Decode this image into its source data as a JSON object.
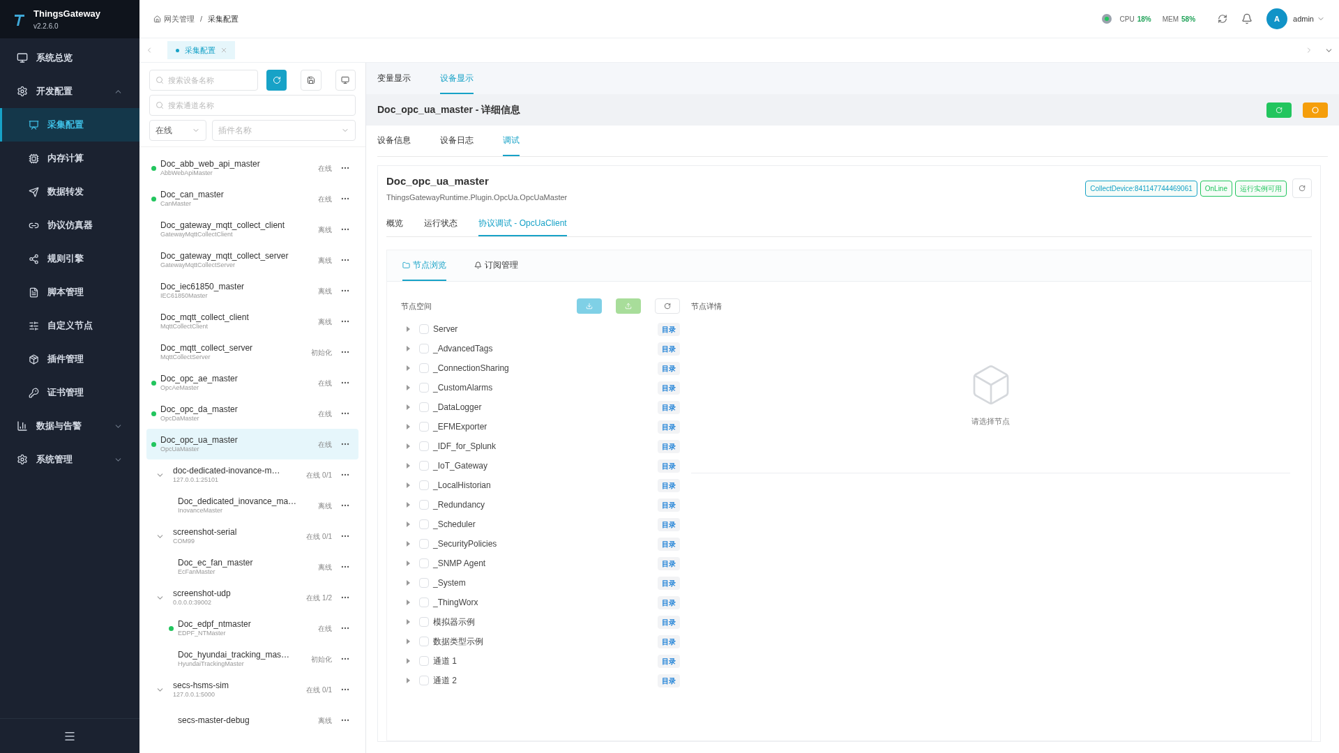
{
  "sidebar": {
    "app_name": "ThingsGateway",
    "version": "v2.2.6.0",
    "items": [
      {
        "label": "系统总览",
        "kind": "item",
        "selected": false
      },
      {
        "label": "开发配置",
        "kind": "group",
        "expanded": true,
        "children": [
          {
            "label": "采集配置",
            "selected": true
          },
          {
            "label": "内存计算",
            "selected": false
          },
          {
            "label": "数据转发",
            "selected": false
          },
          {
            "label": "协议仿真器",
            "selected": false
          },
          {
            "label": "规则引擎",
            "selected": false
          },
          {
            "label": "脚本管理",
            "selected": false
          },
          {
            "label": "自定义节点",
            "selected": false
          },
          {
            "label": "插件管理",
            "selected": false
          },
          {
            "label": "证书管理",
            "selected": false
          }
        ]
      },
      {
        "label": "数据与告警",
        "kind": "group",
        "expanded": false
      },
      {
        "label": "系统管理",
        "kind": "group",
        "expanded": false
      }
    ]
  },
  "header": {
    "breadcrumb": {
      "items": [
        "网关管理",
        "采集配置"
      ],
      "separator": "/"
    },
    "cpu_label": "CPU",
    "cpu_value": "18%",
    "mem_label": "MEM",
    "mem_value": "58%",
    "avatar": "A",
    "user": "admin"
  },
  "page_tabs": [
    {
      "label": "采集配置",
      "selected": true
    }
  ],
  "device_panel": {
    "search_device": {
      "placeholder": "搜索设备名称"
    },
    "search_channel": {
      "placeholder": "搜索通道名称"
    },
    "status_filter": {
      "value": "在线"
    },
    "plugin_filter": {
      "placeholder": "插件名称"
    },
    "items": [
      {
        "kind": "device",
        "name": "Doc_abb_web_api_master",
        "plugin": "AbbWebApiMaster",
        "status": "在线",
        "online": true,
        "selected": false
      },
      {
        "kind": "device",
        "name": "Doc_can_master",
        "plugin": "CanMaster",
        "status": "在线",
        "online": true,
        "selected": false
      },
      {
        "kind": "device",
        "name": "Doc_gateway_mqtt_collect_client",
        "plugin": "GatewayMqttCollectClient",
        "status": "离线",
        "online": false,
        "selected": false
      },
      {
        "kind": "device",
        "name": "Doc_gateway_mqtt_collect_server",
        "plugin": "GatewayMqttCollectServer",
        "status": "离线",
        "online": false,
        "selected": false
      },
      {
        "kind": "device",
        "name": "Doc_iec61850_master",
        "plugin": "IEC61850Master",
        "status": "离线",
        "online": false,
        "selected": false
      },
      {
        "kind": "device",
        "name": "Doc_mqtt_collect_client",
        "plugin": "MqttCollectClient",
        "status": "离线",
        "online": false,
        "selected": false
      },
      {
        "kind": "device",
        "name": "Doc_mqtt_collect_server",
        "plugin": "MqttCollectServer",
        "status": "初始化",
        "online": false,
        "selected": false
      },
      {
        "kind": "device",
        "name": "Doc_opc_ae_master",
        "plugin": "OpcAeMaster",
        "status": "在线",
        "online": true,
        "selected": false
      },
      {
        "kind": "device",
        "name": "Doc_opc_da_master",
        "plugin": "OpcDaMaster",
        "status": "在线",
        "online": true,
        "selected": false
      },
      {
        "kind": "device",
        "name": "Doc_opc_ua_master",
        "plugin": "OpcUaMaster",
        "status": "在线",
        "online": true,
        "selected": true
      },
      {
        "kind": "channel",
        "name": "doc-dedicated-inovance-m…",
        "address": "127.0.0.1:25101",
        "status": "在线 0/1",
        "expanded": true,
        "children": [
          {
            "kind": "device",
            "name": "Doc_dedicated_inovance_ma…",
            "plugin": "InovanceMaster",
            "status": "离线",
            "online": false,
            "selected": false
          }
        ]
      },
      {
        "kind": "channel",
        "name": "screenshot-serial",
        "address": "COM99",
        "status": "在线 0/1",
        "expanded": true,
        "children": [
          {
            "kind": "device",
            "name": "Doc_ec_fan_master",
            "plugin": "EcFanMaster",
            "status": "离线",
            "online": false,
            "selected": false
          }
        ]
      },
      {
        "kind": "channel",
        "name": "screenshot-udp",
        "address": "0.0.0.0:39002",
        "status": "在线 1/2",
        "expanded": true,
        "children": [
          {
            "kind": "device",
            "name": "Doc_edpf_ntmaster",
            "plugin": "EDPF_NTMaster",
            "status": "在线",
            "online": true,
            "selected": false
          },
          {
            "kind": "device",
            "name": "Doc_hyundai_tracking_mas…",
            "plugin": "HyundaiTrackingMaster",
            "status": "初始化",
            "online": false,
            "selected": false
          }
        ]
      },
      {
        "kind": "channel",
        "name": "secs-hsms-sim",
        "address": "127.0.0.1:5000",
        "status": "在线 0/1",
        "expanded": true,
        "children": [
          {
            "kind": "device",
            "name": "secs-master-debug",
            "status": "离线",
            "online": false,
            "selected": false
          }
        ]
      }
    ]
  },
  "view_tabs": [
    {
      "label": "变量显示",
      "selected": false
    },
    {
      "label": "设备显示",
      "selected": true
    }
  ],
  "detail": {
    "title": "Doc_opc_ua_master - 详细信息",
    "tabs": [
      {
        "label": "设备信息",
        "selected": false
      },
      {
        "label": "设备日志",
        "selected": false
      },
      {
        "label": "调试",
        "selected": true
      }
    ],
    "device_name": "Doc_opc_ua_master",
    "plugin": "ThingsGatewayRuntime.Plugin.OpcUa.OpcUaMaster",
    "tags": [
      {
        "text": "CollectDevice:841147744469061",
        "color": "#17a2c7"
      },
      {
        "text": "OnLine",
        "color": "#22c55e"
      },
      {
        "text": "运行实例可用",
        "color": "#22c55e"
      }
    ],
    "sub_tabs": [
      {
        "label": "概览",
        "selected": false
      },
      {
        "label": "运行状态",
        "selected": false
      },
      {
        "label": "协议调试 - OpcUaClient",
        "selected": true
      }
    ],
    "debug_tabs": [
      {
        "label": "节点浏览",
        "selected": true
      },
      {
        "label": "订阅管理",
        "selected": false
      }
    ],
    "node_space_label": "节点空间",
    "node_detail_label": "节点详情",
    "empty_text": "请选择节点",
    "nodes": [
      {
        "label": "Server",
        "tag": "目录",
        "checked": false,
        "expanded": false
      },
      {
        "label": "_AdvancedTags",
        "tag": "目录",
        "checked": false,
        "expanded": false
      },
      {
        "label": "_ConnectionSharing",
        "tag": "目录",
        "checked": false,
        "expanded": false
      },
      {
        "label": "_CustomAlarms",
        "tag": "目录",
        "checked": false,
        "expanded": false
      },
      {
        "label": "_DataLogger",
        "tag": "目录",
        "checked": false,
        "expanded": false
      },
      {
        "label": "_EFMExporter",
        "tag": "目录",
        "checked": false,
        "expanded": false
      },
      {
        "label": "_IDF_for_Splunk",
        "tag": "目录",
        "checked": false,
        "expanded": false
      },
      {
        "label": "_IoT_Gateway",
        "tag": "目录",
        "checked": false,
        "expanded": false
      },
      {
        "label": "_LocalHistorian",
        "tag": "目录",
        "checked": false,
        "expanded": false
      },
      {
        "label": "_Redundancy",
        "tag": "目录",
        "checked": false,
        "expanded": false
      },
      {
        "label": "_Scheduler",
        "tag": "目录",
        "checked": false,
        "expanded": false
      },
      {
        "label": "_SecurityPolicies",
        "tag": "目录",
        "checked": false,
        "expanded": false
      },
      {
        "label": "_SNMP Agent",
        "tag": "目录",
        "checked": false,
        "expanded": false
      },
      {
        "label": "_System",
        "tag": "目录",
        "checked": false,
        "expanded": false
      },
      {
        "label": "_ThingWorx",
        "tag": "目录",
        "checked": false,
        "expanded": false
      },
      {
        "label": "模拟器示例",
        "tag": "目录",
        "checked": false,
        "expanded": false
      },
      {
        "label": "数据类型示例",
        "tag": "目录",
        "checked": false,
        "expanded": false
      },
      {
        "label": "通道 1",
        "tag": "目录",
        "checked": false,
        "expanded": false
      },
      {
        "label": "通道 2",
        "tag": "目录",
        "checked": false,
        "expanded": false
      }
    ]
  }
}
